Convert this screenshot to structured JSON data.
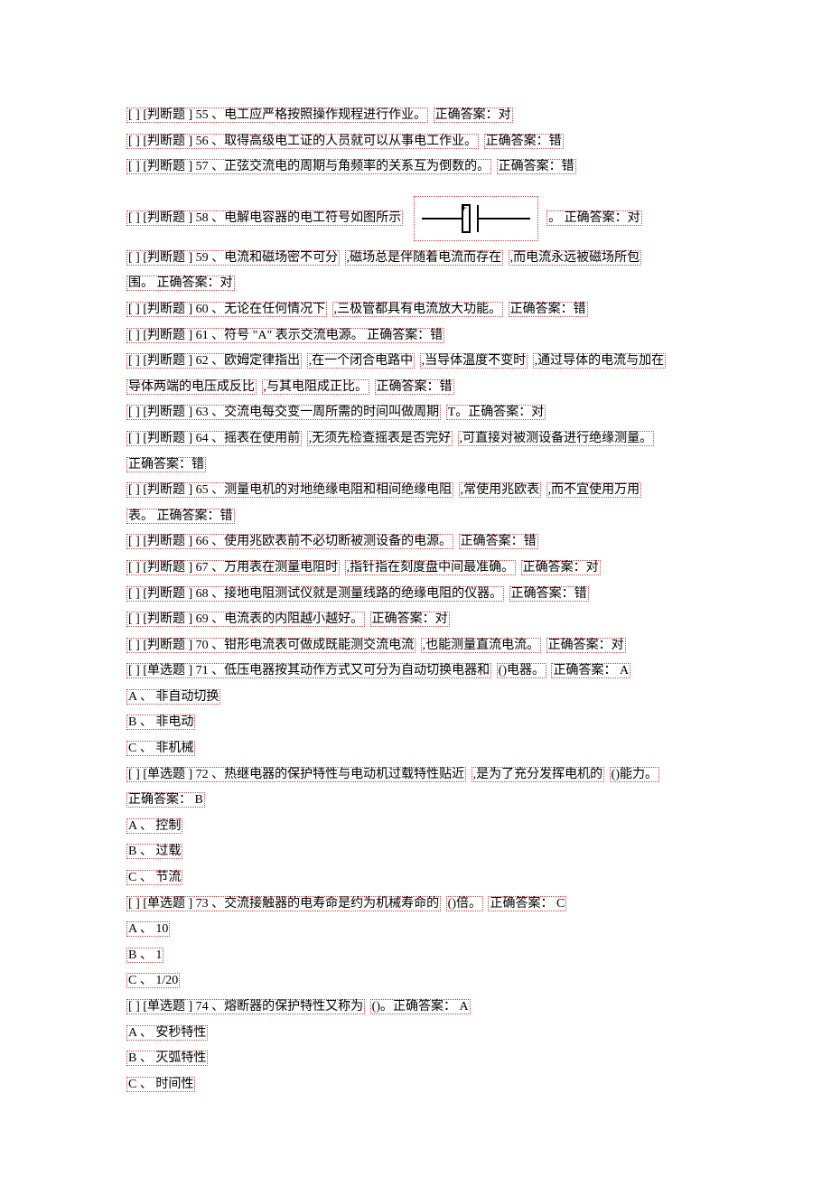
{
  "q55": {
    "pre": "[ ] [判断题 ] 55 、电工应严格按照操作规程进行作业。",
    "ans": "正确答案：对"
  },
  "q56": {
    "pre": "[ ] [判断题 ] 56 、取得高级电工证的人员就可以从事电工作业。",
    "ans": "正确答案：错"
  },
  "q57": {
    "pre": "[ ] [判断题 ] 57 、正弦交流电的周期与角频率的关系互为倒数的。",
    "ans": "正确答案：错"
  },
  "q58": {
    "pre": "[ ] [判断题 ] 58 、电解电容器的电工符号如图所示",
    "post": "。 正确答案：对"
  },
  "q59": {
    "a": "[ ] [判断题 ] 59 、电流和磁场密不可分",
    "b": ",磁场总是伴随着电流而存在",
    "c": ",而电流永远被磁场所包",
    "d": "围。 正确答案：对"
  },
  "q60": {
    "a": "[ ] [判断题 ] 60 、无论在任何情况下",
    "b": ",三极管都具有电流放大功能。",
    "ans": "正确答案：错"
  },
  "q61": {
    "a": "[ ] [判断题 ] 61 、符号 \"A\" 表示交流电源。 正确答案：错"
  },
  "q62": {
    "a": "[ ] [判断题 ] 62 、欧姆定律指出",
    "b": ",在一个闭合电路中",
    "c": ",当导体温度不变时",
    "d": ",通过导体的电流与加在",
    "e": "导体两端的电压成反比",
    "f": ",与其电阻成正比。",
    "ans": "正确答案：错"
  },
  "q63": {
    "a": "[ ] [判断题 ] 63 、交流电每交变一周所需的时间叫做周期",
    "b": "T。正确答案：对"
  },
  "q64": {
    "a": "[ ] [判断题 ] 64 、摇表在使用前",
    "b": ",无须先检查摇表是否完好",
    "c": ",可直接对被测设备进行绝缘测量。",
    "d": "正确答案：错"
  },
  "q65": {
    "a": "[ ] [判断题 ] 65 、测量电机的对地绝缘电阻和相间绝缘电阻",
    "b": ",常使用兆欧表",
    "c": ",而不宜使用万用",
    "d": "表。 正确答案：错"
  },
  "q66": {
    "a": "[ ] [判断题 ] 66 、使用兆欧表前不必切断被测设备的电源。",
    "ans": "正确答案：错"
  },
  "q67": {
    "a": "[ ] [判断题 ] 67 、万用表在测量电阻时",
    "b": ",指针指在刻度盘中间最准确。",
    "ans": "正确答案：对"
  },
  "q68": {
    "a": "[ ] [判断题 ] 68 、接地电阻测试仪就是测量线路的绝缘电阻的仪器。",
    "ans": "正确答案：错"
  },
  "q69": {
    "a": "[ ] [判断题 ] 69 、电流表的内阻越小越好。",
    "ans": "正确答案：对"
  },
  "q70": {
    "a": "[ ] [判断题 ] 70 、钳形电流表可做成既能测交流电流",
    "b": ",也能测量直流电流。",
    "ans": "正确答案：对"
  },
  "q71": {
    "a": "[ ] [单选题 ] 71 、低压电器按其动作方式又可分为自动切换电器和",
    "b": "()电器。",
    "ans": "正确答案： A",
    "optA": "A 、 非自动切换",
    "optB": "B 、 非电动",
    "optC": "C 、 非机械"
  },
  "q72": {
    "a": "[ ] [单选题 ] 72 、热继电器的保护特性与电动机过载特性贴近",
    "b": ",是为了充分发挥电机的",
    "c": "()能力。",
    "ans": "正确答案： B",
    "optA": "A 、 控制",
    "optB": "B 、 过载",
    "optC": "C 、 节流"
  },
  "q73": {
    "a": "[ ] [单选题 ] 73 、交流接触器的电寿命是约为机械寿命的",
    "b": "()倍。",
    "ans": "正确答案： C",
    "optA": "A 、 10",
    "optB": "B 、 1",
    "optC": "C 、 1/20"
  },
  "q74": {
    "a": "[ ] [单选题 ] 74 、熔断器的保护特性又称为",
    "b": "()。正确答案： A",
    "optA": "A 、 安秒特性",
    "optB": "B 、 灭弧特性",
    "optC": "C 、 时间性"
  }
}
